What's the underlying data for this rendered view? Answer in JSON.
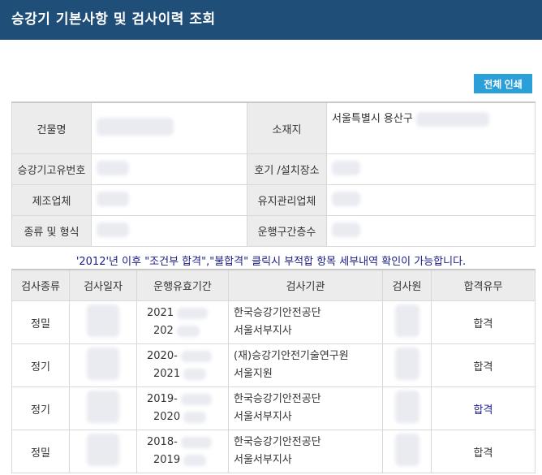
{
  "title": "승강기 기본사항 및 검사이력 조회",
  "print_button": "전체 인쇄",
  "info": {
    "building_label": "건물명",
    "location_label": "소재지",
    "location_value": "서울특별시 용산구",
    "elevator_id_label": "승강기고유번호",
    "unit_place_label": "호기 /설치장소",
    "manufacturer_label": "제조업체",
    "maintenance_label": "유지관리업체",
    "type_label": "종류 및 형식",
    "floors_label": "운행구간층수"
  },
  "notice": "'2012'년 이후 \"조건부 합격\",\"불합격\" 클릭시 부적합 항목 세부내역 확인이 가능합니다.",
  "history": {
    "headers": [
      "검사종류",
      "검사일자",
      "운행유효기간",
      "검사기관",
      "검사원",
      "합격유무"
    ],
    "rows": [
      {
        "kind": "정밀",
        "period_start": "2021",
        "period_end": "202",
        "agency_line1": "한국승강기안전공단",
        "agency_line2": "서울서부지사",
        "result": "합격"
      },
      {
        "kind": "정기",
        "period_start": "2020-",
        "period_end": "2021",
        "agency_line1": "(재)승강기안전기술연구원",
        "agency_line2": "서울지원",
        "result": "합격"
      },
      {
        "kind": "정기",
        "period_start": "2019-",
        "period_end": "2020",
        "agency_line1": "한국승강기안전공단",
        "agency_line2": "서울서부지사",
        "result": "합격"
      },
      {
        "kind": "정밀",
        "period_start": "2018-",
        "period_end": "2019",
        "agency_line1": "한국승강기안전공단",
        "agency_line2": "서울서부지사",
        "result": "합격"
      }
    ]
  }
}
